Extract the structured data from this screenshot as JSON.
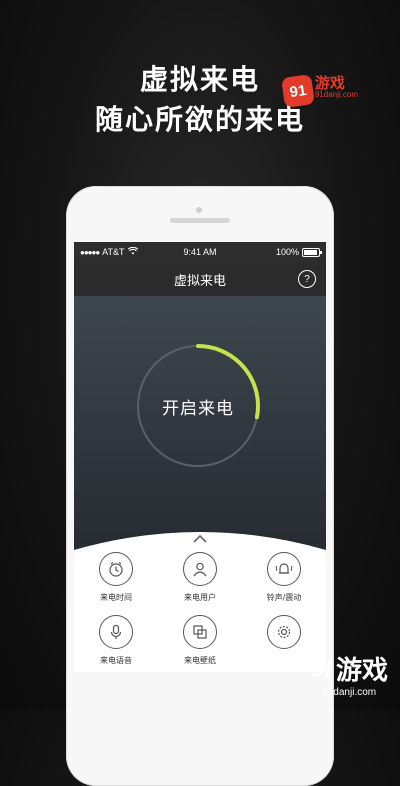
{
  "headline": {
    "line1": "虚拟来电",
    "line2": "随心所欲的来电"
  },
  "watermark_top": {
    "badge": "91",
    "cn": "游戏",
    "en": "91danji.com"
  },
  "statusbar": {
    "carrier": "AT&T",
    "time": "9:41 AM",
    "battery": "100%"
  },
  "navbar": {
    "title": "虚拟来电",
    "help": "?"
  },
  "main": {
    "start_button": "开启来电",
    "progress": 0.28
  },
  "menu": {
    "items": [
      {
        "label": "来电时间",
        "icon": "clock-icon"
      },
      {
        "label": "来电用户",
        "icon": "user-icon"
      },
      {
        "label": "铃声/震动",
        "icon": "bell-icon"
      },
      {
        "label": "来电语音",
        "icon": "microphone-icon"
      },
      {
        "label": "来电壁纸",
        "icon": "wallpaper-icon"
      },
      {
        "label": "",
        "icon": "settings-icon"
      }
    ]
  },
  "watermark_bottom": {
    "badge": "9l",
    "cn": "游戏",
    "en": "91danji.com"
  },
  "colors": {
    "accent": "#c6e24a",
    "navbar": "#2b2b2b",
    "background": "#151515"
  }
}
